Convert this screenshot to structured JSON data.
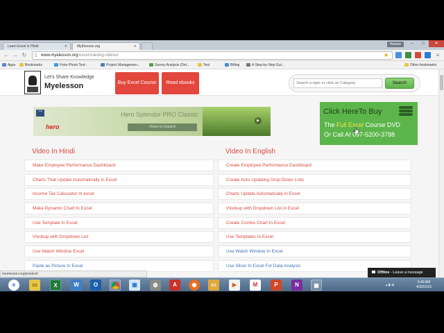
{
  "browser": {
    "tabs": [
      {
        "label": "Learn Excel in Hindi"
      },
      {
        "label": "MyElesson.org"
      }
    ],
    "user_badge": "Heman",
    "url_host": "www.myelesson.org",
    "url_path": "/excel-training-videos/",
    "bookmarks": [
      {
        "label": "Apps",
        "color": "#5a87c6"
      },
      {
        "label": "Bookmarks",
        "color": "#e8c547"
      },
      {
        "label": "Fotor Photo Text -",
        "color": "#3c9ad6"
      },
      {
        "label": "Project Managemen...",
        "color": "#4e7fb8"
      },
      {
        "label": "Survey Analysis (Det...",
        "color": "#5aa14b"
      },
      {
        "label": "Test",
        "color": "#e8c547"
      },
      {
        "label": "Billing",
        "color": "#4c8ad0"
      },
      {
        "label": "A Step-by-Step Gui...",
        "color": "#777777"
      },
      {
        "label": "Other bookmarks",
        "color": "#e8c547"
      }
    ],
    "status_url": "myelesson.org/product/"
  },
  "header": {
    "tagline": "Let's Share Knowledge",
    "brand": "Myelesson",
    "buy_button": "Buy Excel Course",
    "ebooks_button": "Read ebooks",
    "search_placeholder": "Search a topic or click on Category",
    "search_button": "Search"
  },
  "banner": {
    "badge": "TVS",
    "brand": "hero",
    "title": "Hero Splendor PRO Classic",
    "expand": "Hover to Expand",
    "play": "▶"
  },
  "promo": {
    "line1": "Click HereTo Buy",
    "line2_pre": "The ",
    "line2_hl": "Full Excel",
    "line2_post": " Course DVD",
    "line3": "Or Call At 097-5200-3788"
  },
  "hindi": {
    "heading": "Video In Hindi",
    "items": [
      "Make Employee Performance Dashboard",
      "Charts That Update Automatically in Excel",
      "Income Tax Calculator In excel",
      "Make Dynamic Chart In Excel",
      "Use Template In Excel",
      "Vlookup with Dropdown List",
      "Use Watch Window Excel",
      "Paste as Picture In Excel"
    ]
  },
  "english": {
    "heading": "Video In English",
    "items": [
      "Create Employee Performance Dashboard",
      "Create Auto Updating Drop-Down Lists",
      "Charts Update Automatically in Excel",
      "Vlookup with Dropdown List in Excel",
      "Create Combo Chart In Excel",
      "Use Templates In Excel",
      "Use Watch Window In Excel",
      "Use Slicer In Excel For Data Analysis"
    ]
  },
  "chat": {
    "status": "Offline",
    "text": " - Leave a message"
  },
  "taskbar": {
    "time": "6:43 AM",
    "date": "4/30/2015"
  }
}
